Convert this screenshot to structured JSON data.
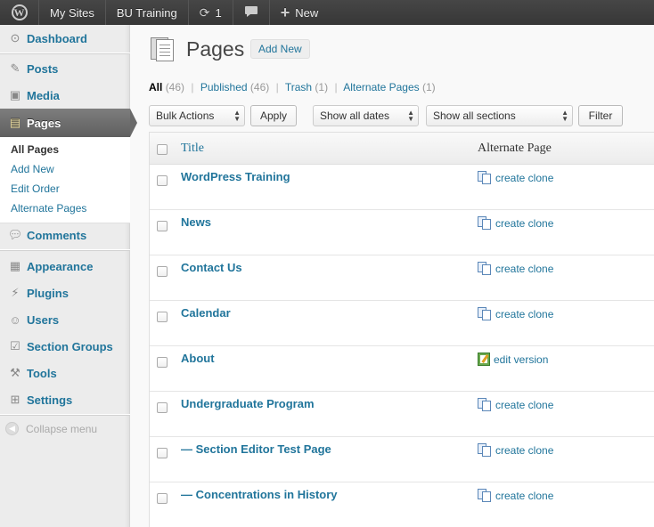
{
  "admin_bar": {
    "wp_logo": "W",
    "my_sites": "My Sites",
    "site_name": "BU Training",
    "updates_count": "1",
    "updates_icon": "refresh-icon",
    "comments_icon": "comment-bubble-icon",
    "new_label": "New",
    "new_icon": "plus-icon"
  },
  "sidebar": {
    "dashboard": "Dashboard",
    "posts": "Posts",
    "media": "Media",
    "pages": "Pages",
    "submenu": [
      "All Pages",
      "Add New",
      "Edit Order",
      "Alternate Pages"
    ],
    "comments": "Comments",
    "appearance": "Appearance",
    "plugins": "Plugins",
    "users": "Users",
    "section_groups": "Section Groups",
    "tools": "Tools",
    "settings": "Settings",
    "collapse": "Collapse menu"
  },
  "header": {
    "title": "Pages",
    "add_new": "Add New"
  },
  "filters": {
    "all": "All",
    "all_count": "(46)",
    "published": "Published",
    "published_count": "(46)",
    "trash": "Trash",
    "trash_count": "(1)",
    "alternate": "Alternate Pages",
    "alternate_count": "(1)"
  },
  "toolbar": {
    "bulk_actions": "Bulk Actions",
    "apply": "Apply",
    "dates": "Show all dates",
    "sections": "Show all sections",
    "filter": "Filter"
  },
  "table": {
    "col_title": "Title",
    "col_alternate": "Alternate Page",
    "rows": [
      {
        "title": "WordPress Training",
        "action": "create clone",
        "icon": "clone-icon"
      },
      {
        "title": "News",
        "action": "create clone",
        "icon": "clone-icon"
      },
      {
        "title": "Contact Us",
        "action": "create clone",
        "icon": "clone-icon"
      },
      {
        "title": "Calendar",
        "action": "create clone",
        "icon": "clone-icon"
      },
      {
        "title": "About",
        "action": "edit version",
        "icon": "edit-version-icon"
      },
      {
        "title": "Undergraduate Program",
        "action": "create clone",
        "icon": "clone-icon"
      },
      {
        "title": "— Section Editor Test Page",
        "action": "create clone",
        "icon": "clone-icon"
      },
      {
        "title": "— Concentrations in History",
        "action": "create clone",
        "icon": "clone-icon"
      }
    ]
  }
}
